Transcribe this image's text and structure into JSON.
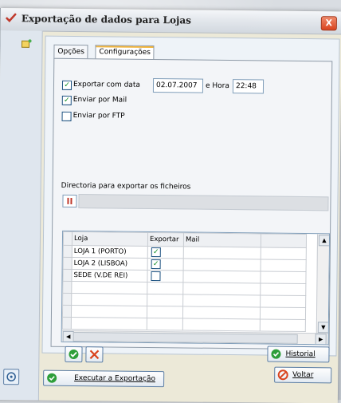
{
  "window": {
    "title": "Exportação de dados para Lojas",
    "close_glyph": "X"
  },
  "tabs": [
    {
      "label": "Opções",
      "active": false
    },
    {
      "label": "Configurações",
      "active": true
    }
  ],
  "export_date": {
    "label": "Exportar com data",
    "checked": true,
    "date": "02.07.2007",
    "hour_label": "e Hora",
    "hour": "22:48"
  },
  "send_mail": {
    "label": "Enviar por Mail",
    "checked": true
  },
  "send_ftp": {
    "label": "Enviar por FTP",
    "checked": false
  },
  "directory": {
    "label": "Directoria para exportar os ficheiros",
    "value": ""
  },
  "grid": {
    "columns": [
      "Loja",
      "Exportar",
      "Mail"
    ],
    "rows": [
      {
        "loja": "LOJA 1 (PORTO)",
        "exportar": true,
        "mail": ""
      },
      {
        "loja": "LOJA 2 (LISBOA)",
        "exportar": true,
        "mail": ""
      },
      {
        "loja": "SEDE (V.DE REI)",
        "exportar": false,
        "mail": ""
      }
    ]
  },
  "buttons": {
    "historial": "Historial",
    "executar": "Executar a Exportação",
    "voltar": "Voltar"
  },
  "colors": {
    "accent": "#f3b53a",
    "ok_green": "#0b8a1f",
    "cancel_red": "#d9431e"
  }
}
